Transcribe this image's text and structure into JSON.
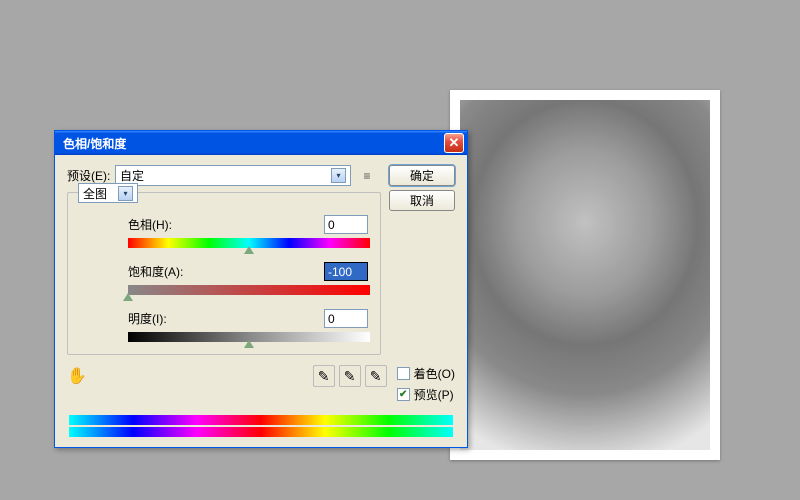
{
  "dialog": {
    "title": "色相/饱和度",
    "preset_label": "预设(E):",
    "preset_value": "自定",
    "channel_value": "全图",
    "ok_label": "确定",
    "cancel_label": "取消",
    "hue_label": "色相(H):",
    "hue_value": "0",
    "sat_label": "饱和度(A):",
    "sat_value": "-100",
    "lig_label": "明度(I):",
    "lig_value": "0",
    "colorize_label": "着色(O)",
    "preview_label": "预览(P)",
    "colorize_checked": false,
    "preview_checked": true
  }
}
